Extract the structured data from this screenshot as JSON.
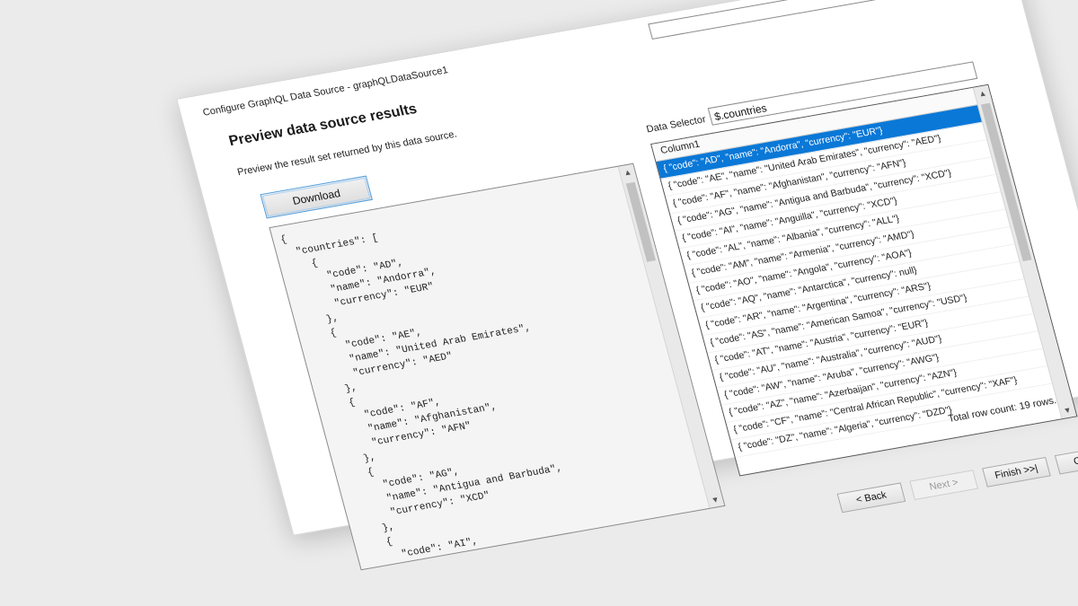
{
  "window": {
    "title": "Configure GraphQL Data Source - graphQLDataSource1"
  },
  "page": {
    "heading": "Preview data source results",
    "description": "Preview the result set returned by this data source."
  },
  "toolbar": {
    "download_label": "Download"
  },
  "json_preview": {
    "text": "{\n  \"countries\": [\n    {\n      \"code\": \"AD\",\n      \"name\": \"Andorra\",\n      \"currency\": \"EUR\"\n    },\n    {\n      \"code\": \"AE\",\n      \"name\": \"United Arab Emirates\",\n      \"currency\": \"AED\"\n    },\n    {\n      \"code\": \"AF\",\n      \"name\": \"Afghanistan\",\n      \"currency\": \"AFN\"\n    },\n    {\n      \"code\": \"AG\",\n      \"name\": \"Antigua and Barbuda\",\n      \"currency\": \"XCD\"\n    },\n    {\n      \"code\": \"AI\",\n      \"name\": \"Anguilla\",\n      \"currency\": \"XCD\"\n    },\n    {"
  },
  "data_selector": {
    "label": "Data Selector",
    "value": "$.countries"
  },
  "grid": {
    "column_header": "Column1",
    "selected_index": 0,
    "rows": [
      "{  \"code\": \"AD\",  \"name\": \"Andorra\",  \"currency\": \"EUR\"}",
      "{  \"code\": \"AE\",  \"name\": \"United Arab Emirates\",  \"currency\": \"AED\"}",
      "{  \"code\": \"AF\",  \"name\": \"Afghanistan\",  \"currency\": \"AFN\"}",
      "{  \"code\": \"AG\",  \"name\": \"Antigua and Barbuda\",  \"currency\": \"XCD\"}",
      "{  \"code\": \"AI\",  \"name\": \"Anguilla\",  \"currency\": \"XCD\"}",
      "{  \"code\": \"AL\",  \"name\": \"Albania\",  \"currency\": \"ALL\"}",
      "{  \"code\": \"AM\",  \"name\": \"Armenia\",  \"currency\": \"AMD\"}",
      "{  \"code\": \"AO\",  \"name\": \"Angola\",  \"currency\": \"AOA\"}",
      "{  \"code\": \"AQ\",  \"name\": \"Antarctica\",  \"currency\": null}",
      "{  \"code\": \"AR\",  \"name\": \"Argentina\",  \"currency\": \"ARS\"}",
      "{  \"code\": \"AS\",  \"name\": \"American Samoa\",  \"currency\": \"USD\"}",
      "{  \"code\": \"AT\",  \"name\": \"Austria\",  \"currency\": \"EUR\"}",
      "{  \"code\": \"AU\",  \"name\": \"Australia\",  \"currency\": \"AUD\"}",
      "{  \"code\": \"AW\",  \"name\": \"Aruba\",  \"currency\": \"AWG\"}",
      "{  \"code\": \"AZ\",  \"name\": \"Azerbaijan\",  \"currency\": \"AZN\"}",
      "{  \"code\": \"CF\",  \"name\": \"Central African Republic\",  \"currency\": \"XAF\"}",
      "{  \"code\": \"DZ\",  \"name\": \"Algeria\",  \"currency\": \"DZD\"}"
    ],
    "row_count_text": "Total row count: 19 rows."
  },
  "footer": {
    "back_label": "< Back",
    "next_label": "Next >",
    "finish_label": "Finish >>|",
    "cancel_label": "Cancel"
  }
}
